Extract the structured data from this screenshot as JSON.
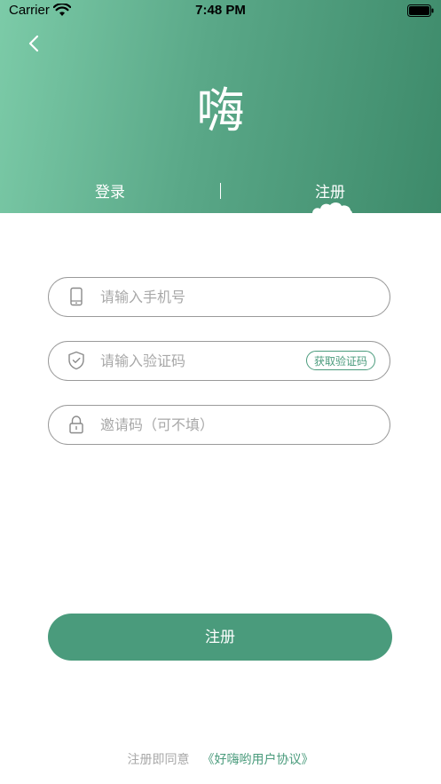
{
  "status_bar": {
    "carrier": "Carrier",
    "time": "7:48 PM"
  },
  "header": {
    "title": "嗨",
    "tabs": [
      {
        "label": "登录"
      },
      {
        "label": "注册"
      }
    ],
    "active_tab": "注册"
  },
  "form": {
    "phone": {
      "placeholder": "请输入手机号",
      "value": "",
      "icon": "phone-icon"
    },
    "code": {
      "placeholder": "请输入验证码",
      "value": "",
      "icon": "shield-check-icon",
      "button_label": "获取验证码"
    },
    "invite": {
      "placeholder": "邀请码（可不填）",
      "value": "",
      "icon": "lock-icon"
    },
    "submit_label": "注册"
  },
  "footer": {
    "text": "注册即同意",
    "link": "《好嗨哟用户协议》"
  },
  "colors": {
    "accent": "#4a9b7c",
    "header_start": "#7ccba8",
    "header_end": "#3d8a6a",
    "placeholder": "#a8a8a8"
  }
}
